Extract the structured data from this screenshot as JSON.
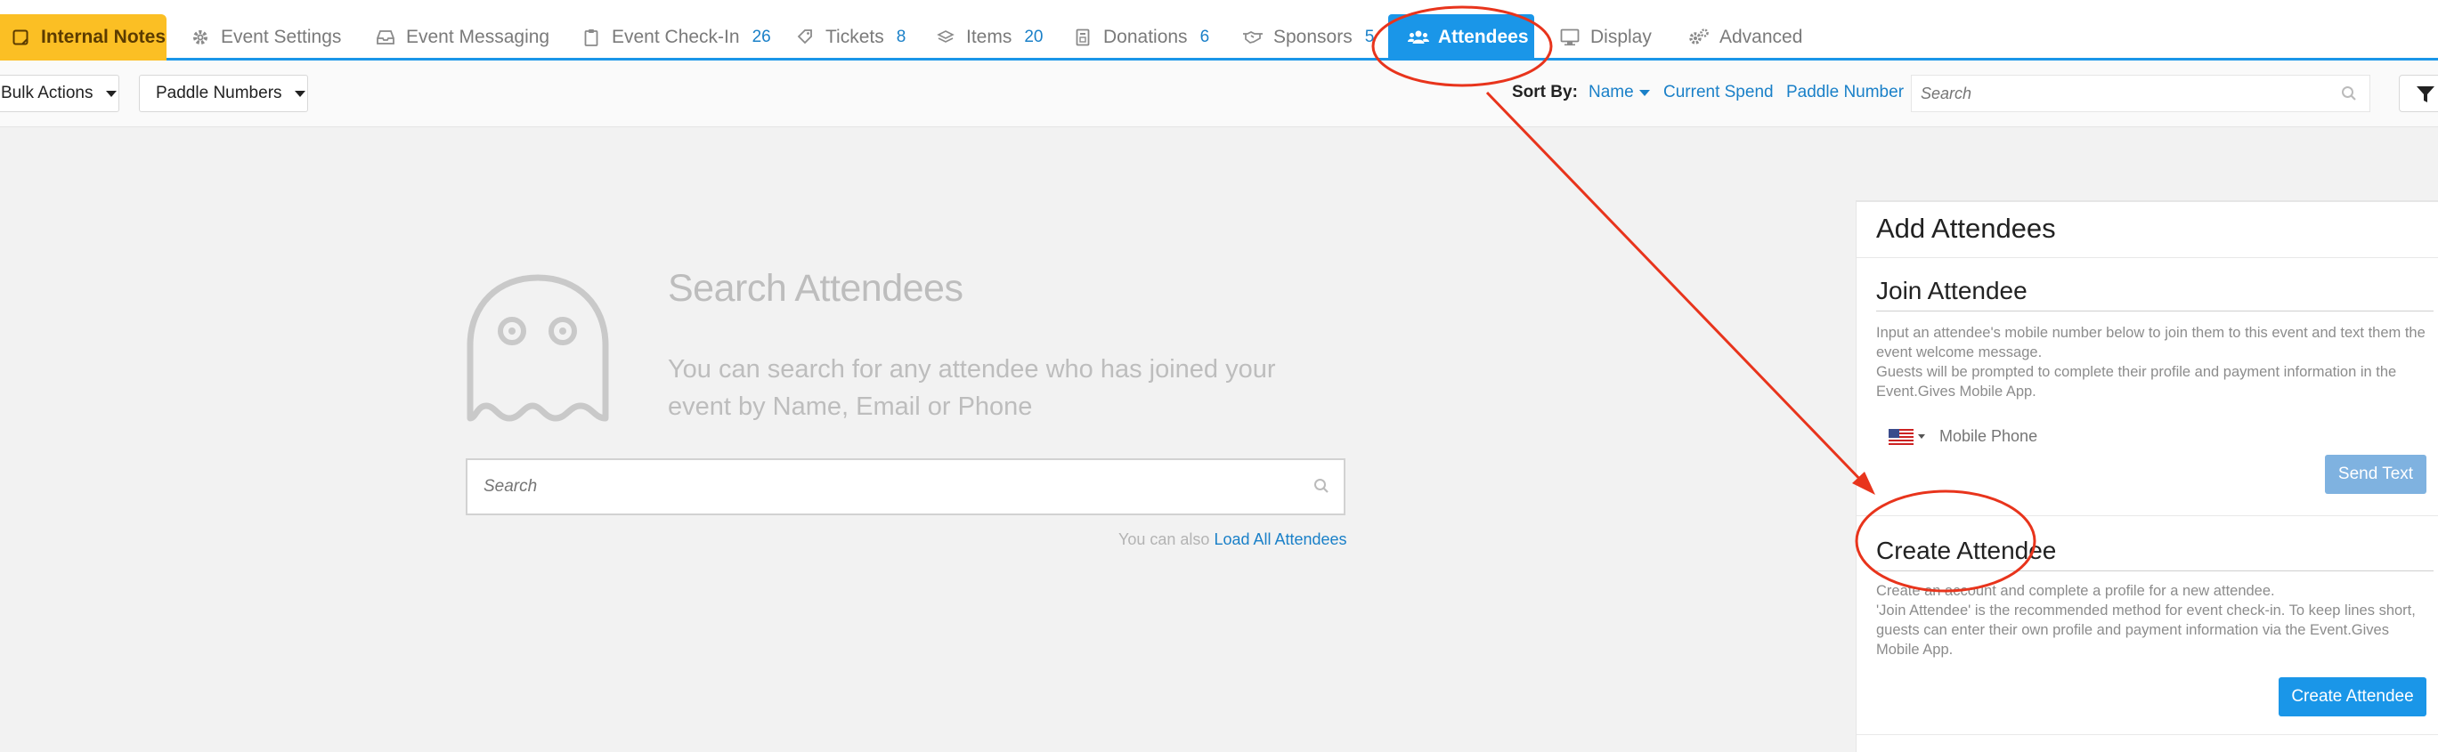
{
  "tabs": [
    {
      "label": "Internal Notes",
      "icon": "sticky-note-icon"
    },
    {
      "label": "Event Settings",
      "icon": "gear-icon"
    },
    {
      "label": "Event Messaging",
      "icon": "inbox-icon"
    },
    {
      "label": "Event Check-In",
      "count": "26",
      "icon": "clipboard-icon"
    },
    {
      "label": "Tickets",
      "count": "8",
      "icon": "ticket-icon"
    },
    {
      "label": "Items",
      "count": "20",
      "icon": "layers-icon"
    },
    {
      "label": "Donations",
      "count": "6",
      "icon": "donation-box-icon"
    },
    {
      "label": "Sponsors",
      "count": "5",
      "icon": "handshake-icon"
    },
    {
      "label": "Attendees",
      "icon": "users-icon",
      "active": true
    },
    {
      "label": "Display",
      "icon": "monitor-icon"
    },
    {
      "label": "Advanced",
      "icon": "gears-icon"
    }
  ],
  "toolbar": {
    "bulk_actions": "Bulk Actions",
    "paddle_numbers": "Paddle Numbers",
    "sort_by_label": "Sort By:",
    "sort_options": [
      "Name",
      "Current Spend",
      "Paddle Number"
    ],
    "search_placeholder": "Search"
  },
  "empty_state": {
    "title": "Search Attendees",
    "description": "You can search for any attendee who has joined your event by Name, Email or Phone",
    "search_placeholder": "Search",
    "load_prefix": "You can also",
    "load_link": "Load All Attendees"
  },
  "panel": {
    "title": "Add Attendees",
    "join": {
      "title": "Join Attendee",
      "desc_1": "Input an attendee's mobile number below to join them to this event and text them the event welcome message.",
      "desc_2": "Guests will be prompted to complete their profile and payment information in the Event.Gives Mobile App.",
      "phone_placeholder": "Mobile Phone",
      "send_button": "Send Text"
    },
    "create": {
      "title": "Create Attendee",
      "desc_1": "Create an account and complete a profile for a new attendee.",
      "desc_2": "'Join Attendee' is the recommended method for event check-in. To keep lines short, guests can enter their own profile and payment information via the Event.Gives Mobile App.",
      "button": "Create Attendee"
    }
  },
  "colors": {
    "accent": "#1a96e8",
    "notes_tab": "#fbbf24",
    "annotation": "#e8341c"
  }
}
